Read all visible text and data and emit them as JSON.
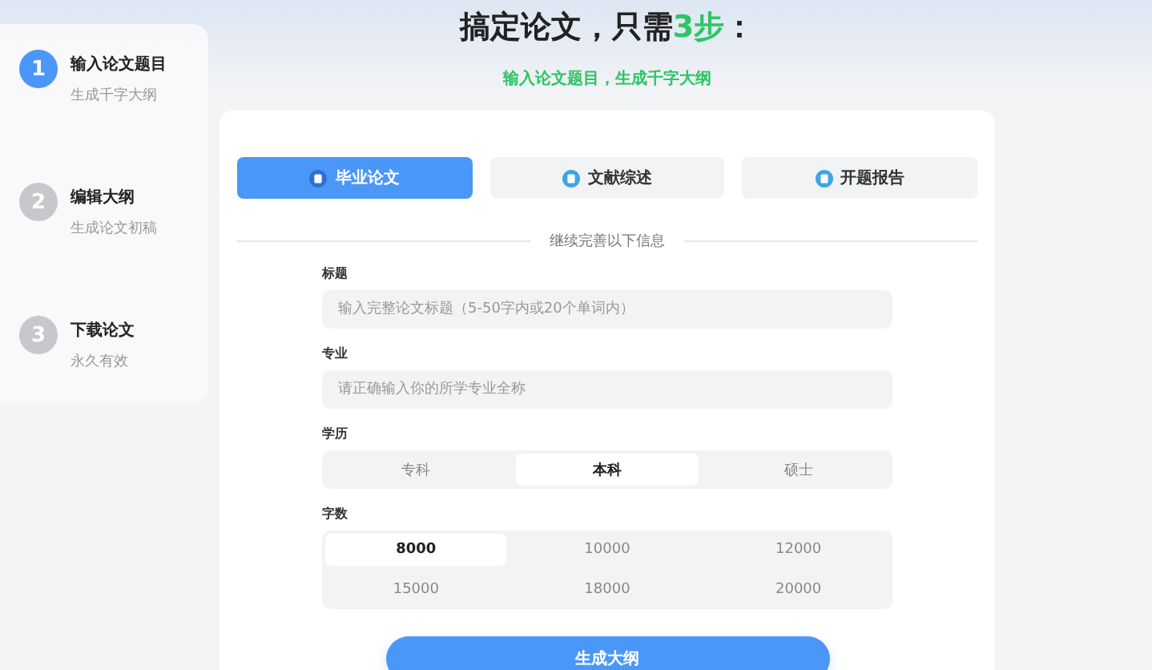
{
  "steps": [
    {
      "number": "1",
      "title": "输入论文题目",
      "subtitle": "生成千字大纲",
      "selected": true
    },
    {
      "number": "2",
      "title": "编辑大纲",
      "subtitle": "生成论文初稿",
      "selected": false
    },
    {
      "number": "3",
      "title": "下载论文",
      "subtitle": "永久有效",
      "selected": false
    }
  ],
  "header": {
    "title": "搞定论文，只需",
    "highlight": "3步",
    "suffix": "：",
    "subtitle": "输入论文题目，生成千字大纲"
  },
  "tabs": [
    {
      "label": "毕业论文",
      "selected": true
    },
    {
      "label": "文献综述",
      "selected": false
    },
    {
      "label": "开题报告",
      "selected": false
    }
  ],
  "divider_text": "继续完善以下信息",
  "fields": [
    {
      "label": "标题",
      "placeholder": "输入完整论文标题（5-50字内或20个单词内）"
    },
    {
      "label": "专业",
      "placeholder": "请正确输入你的所学专业全称"
    }
  ],
  "degree": {
    "label": "学历",
    "options": [
      {
        "label": "专科",
        "selected": false
      },
      {
        "label": "本科",
        "selected": true
      },
      {
        "label": "硕士",
        "selected": false
      }
    ]
  },
  "word_count": {
    "label": "字数",
    "options": [
      {
        "label": "8000",
        "selected": true
      },
      {
        "label": "10000",
        "selected": false
      },
      {
        "label": "12000",
        "selected": false
      },
      {
        "label": "15000",
        "selected": false
      },
      {
        "label": "18000",
        "selected": false
      },
      {
        "label": "20000",
        "selected": false
      }
    ]
  },
  "submit": "生成大纲"
}
